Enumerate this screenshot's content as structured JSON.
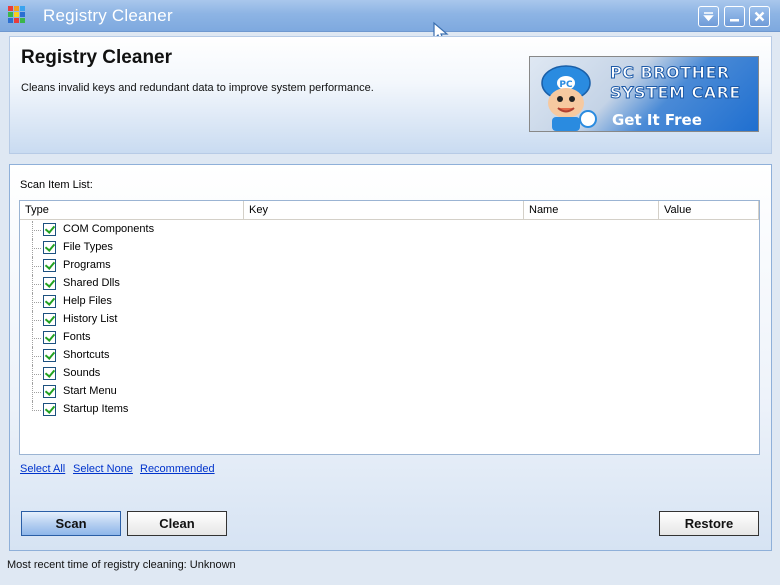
{
  "window": {
    "title": "Registry Cleaner",
    "controls": [
      "menu-icon",
      "minimize-icon",
      "close-icon"
    ]
  },
  "header": {
    "title": "Registry Cleaner",
    "description": "Cleans invalid keys and redundant data to improve system performance.",
    "ad": {
      "line1": "PC BROTHER",
      "line2": "SYSTEM CARE",
      "line3": "Get It Free",
      "mascot_label": "PC"
    }
  },
  "main": {
    "scan_label": "Scan Item List:",
    "columns": [
      "Type",
      "Key",
      "Name",
      "Value"
    ],
    "items": [
      {
        "label": "COM Components",
        "checked": true
      },
      {
        "label": "File Types",
        "checked": true
      },
      {
        "label": "Programs",
        "checked": true
      },
      {
        "label": "Shared Dlls",
        "checked": true
      },
      {
        "label": "Help Files",
        "checked": true
      },
      {
        "label": "History List",
        "checked": true
      },
      {
        "label": "Fonts",
        "checked": true
      },
      {
        "label": "Shortcuts",
        "checked": true
      },
      {
        "label": "Sounds",
        "checked": true
      },
      {
        "label": "Start Menu",
        "checked": true
      },
      {
        "label": "Startup Items",
        "checked": true
      }
    ],
    "links": {
      "select_all": "Select All",
      "select_none": "Select None",
      "recommended": "Recommended"
    },
    "buttons": {
      "scan": "Scan",
      "clean": "Clean",
      "restore": "Restore"
    }
  },
  "status": {
    "text": "Most recent time of registry cleaning: Unknown"
  },
  "colors": {
    "titlebar": "#8db4e4",
    "link": "#0033cc",
    "check": "#21a121"
  }
}
